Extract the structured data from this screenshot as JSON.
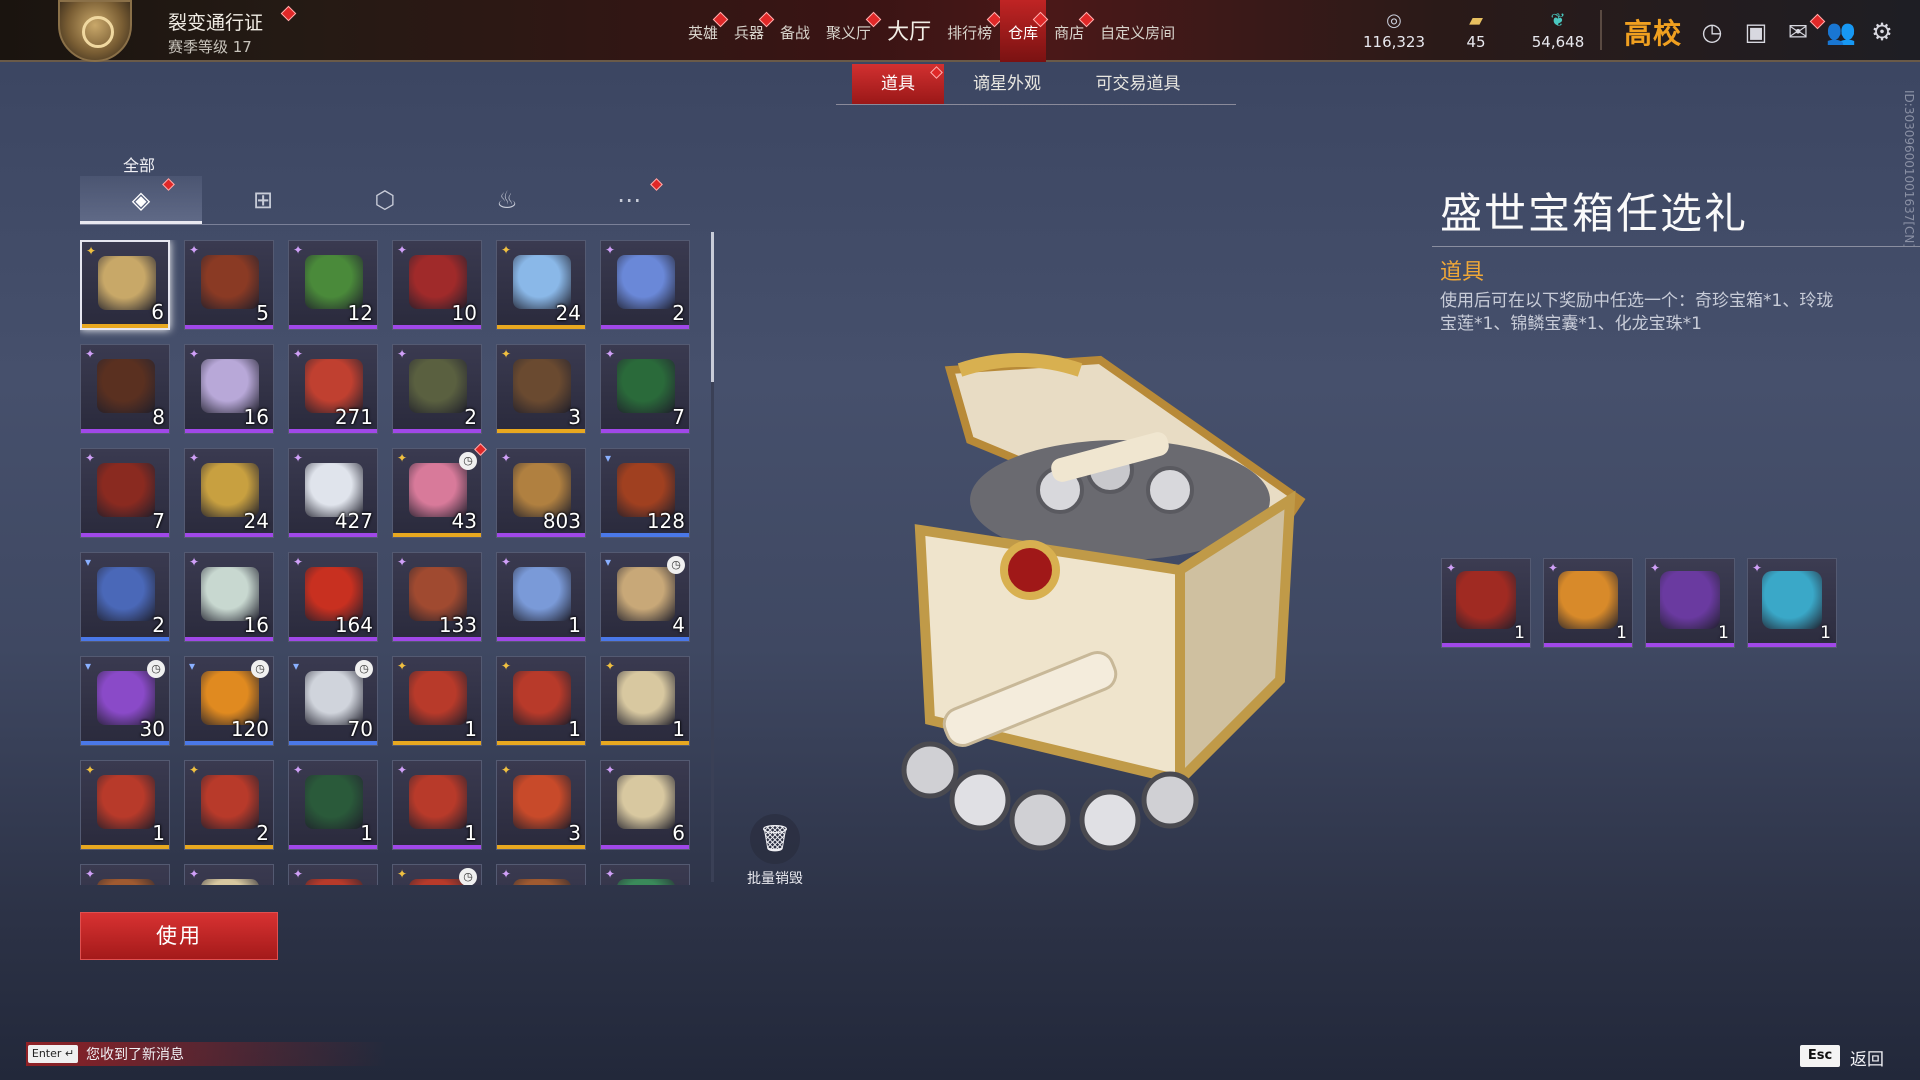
{
  "topbar": {
    "pass_title": "裂变通行证",
    "pass_level": "赛季等级 17",
    "nav": [
      {
        "label": "英雄",
        "dot": true
      },
      {
        "label": "兵器",
        "dot": true
      },
      {
        "label": "备战",
        "dot": false
      },
      {
        "label": "聚义厅",
        "dot": true
      },
      {
        "label": "大厅",
        "dot": false,
        "big": true
      },
      {
        "label": "排行榜",
        "dot": true
      },
      {
        "label": "仓库",
        "dot": true,
        "active": true
      },
      {
        "label": "商店",
        "dot": true
      },
      {
        "label": "自定义房间",
        "dot": false
      }
    ],
    "currencies": [
      {
        "icon": "coin-swirl-icon",
        "value": "116,323"
      },
      {
        "icon": "ticket-icon",
        "value": "45"
      },
      {
        "icon": "feather-icon",
        "value": "54,648"
      }
    ],
    "logo": "高校",
    "icons": [
      "clock-icon",
      "help-book-icon",
      "mail-icon",
      "friends-icon",
      "gear-icon"
    ]
  },
  "subtabs": [
    {
      "label": "道具",
      "active": true,
      "dot": true
    },
    {
      "label": "谪星外观",
      "active": false,
      "dot": false
    },
    {
      "label": "可交易道具",
      "active": false,
      "dot": false
    }
  ],
  "side_id": "ID:303096001001637[CN]",
  "categories": {
    "label": "全部",
    "tabs": [
      {
        "icon": "layers-icon",
        "active": true,
        "dot": true
      },
      {
        "icon": "gift-icon",
        "active": false,
        "dot": false
      },
      {
        "icon": "badge-icon",
        "active": false,
        "dot": false
      },
      {
        "icon": "flame-icon",
        "active": false,
        "dot": false
      },
      {
        "icon": "more-icon",
        "active": false,
        "dot": true
      }
    ]
  },
  "grid": [
    {
      "qty": "6",
      "rarity": "gold",
      "color": "#c8a868",
      "selected": true
    },
    {
      "qty": "5",
      "rarity": "purple",
      "color": "#8a3a24"
    },
    {
      "qty": "12",
      "rarity": "purple",
      "color": "#4a8a3a"
    },
    {
      "qty": "10",
      "rarity": "purple",
      "color": "#a02a2a"
    },
    {
      "qty": "24",
      "rarity": "gold",
      "color": "#8ab8e8"
    },
    {
      "qty": "2",
      "rarity": "purple",
      "color": "#6a88d8"
    },
    {
      "qty": "8",
      "rarity": "purple",
      "color": "#5a3020"
    },
    {
      "qty": "16",
      "rarity": "purple",
      "color": "#b8a8d8"
    },
    {
      "qty": "271",
      "rarity": "purple",
      "color": "#c04030"
    },
    {
      "qty": "2",
      "rarity": "purple",
      "color": "#5a6040"
    },
    {
      "qty": "3",
      "rarity": "gold",
      "color": "#6a4a30"
    },
    {
      "qty": "7",
      "rarity": "purple",
      "color": "#2a6a3a"
    },
    {
      "qty": "7",
      "rarity": "purple",
      "color": "#8a2a20"
    },
    {
      "qty": "24",
      "rarity": "purple",
      "color": "#c8a040"
    },
    {
      "qty": "427",
      "rarity": "purple",
      "color": "#e0e4ec"
    },
    {
      "qty": "43",
      "rarity": "gold",
      "color": "#d87a9a",
      "clock": true,
      "dot": true
    },
    {
      "qty": "803",
      "rarity": "purple",
      "color": "#b08040"
    },
    {
      "qty": "128",
      "rarity": "blue",
      "color": "#a04020"
    },
    {
      "qty": "2",
      "rarity": "blue",
      "color": "#4a68b8"
    },
    {
      "qty": "16",
      "rarity": "purple",
      "color": "#c8d8d0"
    },
    {
      "qty": "164",
      "rarity": "purple",
      "color": "#c83020"
    },
    {
      "qty": "133",
      "rarity": "purple",
      "color": "#a04a30"
    },
    {
      "qty": "1",
      "rarity": "purple",
      "color": "#7a9ad8"
    },
    {
      "qty": "4",
      "rarity": "blue",
      "color": "#c8a878",
      "clock": true
    },
    {
      "qty": "30",
      "rarity": "blue",
      "color": "#8a4ac8",
      "clock": true
    },
    {
      "qty": "120",
      "rarity": "blue",
      "color": "#e08a20",
      "clock": true
    },
    {
      "qty": "70",
      "rarity": "blue",
      "color": "#d0d4dc",
      "clock": true
    },
    {
      "qty": "1",
      "rarity": "gold",
      "color": "#b83a2a"
    },
    {
      "qty": "1",
      "rarity": "gold",
      "color": "#b83a2a"
    },
    {
      "qty": "1",
      "rarity": "gold",
      "color": "#d8c8a0"
    },
    {
      "qty": "1",
      "rarity": "gold",
      "color": "#b83a2a"
    },
    {
      "qty": "2",
      "rarity": "gold",
      "color": "#b83a2a"
    },
    {
      "qty": "1",
      "rarity": "purple",
      "color": "#2a5a3a"
    },
    {
      "qty": "1",
      "rarity": "purple",
      "color": "#b83a2a"
    },
    {
      "qty": "3",
      "rarity": "gold",
      "color": "#c84a2a"
    },
    {
      "qty": "6",
      "rarity": "purple",
      "color": "#d8c8a0"
    },
    {
      "qty": "",
      "rarity": "purple",
      "color": "#a05a30"
    },
    {
      "qty": "",
      "rarity": "purple",
      "color": "#d8c8a0"
    },
    {
      "qty": "",
      "rarity": "purple",
      "color": "#b83a2a"
    },
    {
      "qty": "",
      "rarity": "gold",
      "color": "#b83a2a",
      "clock": true
    },
    {
      "qty": "",
      "rarity": "purple",
      "color": "#a05a30"
    },
    {
      "qty": "",
      "rarity": "purple",
      "color": "#3a8a5a"
    }
  ],
  "use_button": "使用",
  "batch_destroy": "批量销毁",
  "item": {
    "title": "盛世宝箱任选礼",
    "type": "道具",
    "description": "使用后可在以下奖励中任选一个：奇珍宝箱*1、玲珑宝莲*1、锦鳞宝囊*1、化龙宝珠*1",
    "rewards": [
      {
        "qty": "1",
        "color": "#a02a22"
      },
      {
        "qty": "1",
        "color": "#d88a2a"
      },
      {
        "qty": "1",
        "color": "#6a3aa0"
      },
      {
        "qty": "1",
        "color": "#3aa8c8"
      }
    ]
  },
  "bottom": {
    "enter_key": "Enter ↵",
    "message": "您收到了新消息",
    "esc_key": "Esc",
    "esc_label": "返回"
  },
  "colors": {
    "accent_red": "#c82828",
    "type_orange": "#f0a838",
    "rarity_purple": "#a048e8",
    "rarity_gold": "#e8a820",
    "rarity_blue": "#4a78e8"
  }
}
